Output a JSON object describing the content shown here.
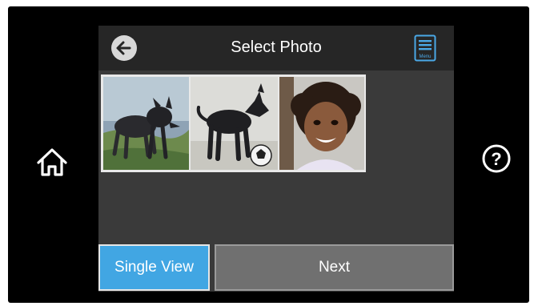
{
  "header": {
    "title": "Select Photo",
    "back_icon": "back-arrow-icon",
    "menu_icon": "menu-icon",
    "menu_label": "Menu"
  },
  "side_buttons": {
    "home_icon": "home-icon",
    "help_icon": "help-icon",
    "help_glyph": "?"
  },
  "thumbnails": [
    {
      "name": "photo-thumbnail-1",
      "icon": "dogs-photo"
    },
    {
      "name": "photo-thumbnail-2",
      "icon": "dog-with-ball-photo"
    },
    {
      "name": "photo-thumbnail-3",
      "icon": "child-photo"
    }
  ],
  "footer": {
    "single_view_label": "Single View",
    "next_label": "Next"
  },
  "colors": {
    "bezel": "#000000",
    "screen_bg": "#3a3a3a",
    "header_bg": "#262626",
    "accent": "#41a6e3",
    "next_button": "#707070"
  }
}
